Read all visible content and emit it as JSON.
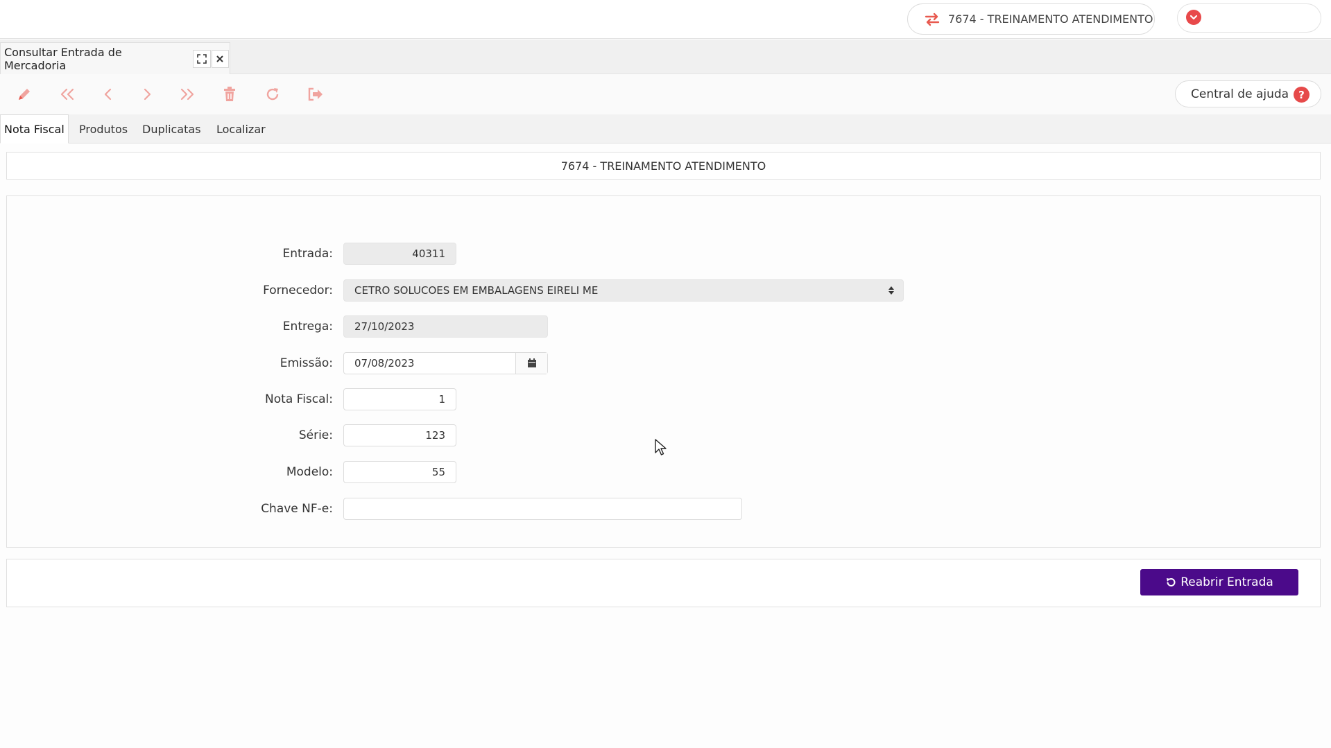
{
  "topbar": {
    "company_label": "7674 - TREINAMENTO ATENDIMENTO",
    "switch_icon": "switch-arrows-icon",
    "user_icon": "chevron-down-icon"
  },
  "window_tab": {
    "title": "Consultar Entrada de Mercadoria",
    "maximize_icon": "maximize-icon",
    "close_icon": "close-icon"
  },
  "toolbar": {
    "icons": [
      "pencil-icon",
      "first-icon",
      "previous-icon",
      "next-icon",
      "last-icon",
      "trash-icon",
      "refresh-icon",
      "exit-icon"
    ],
    "help_label": "Central de ajuda",
    "help_glyph": "?"
  },
  "tabs": [
    {
      "label": "Nota Fiscal",
      "active": true
    },
    {
      "label": "Produtos",
      "active": false
    },
    {
      "label": "Duplicatas",
      "active": false
    },
    {
      "label": "Localizar",
      "active": false
    }
  ],
  "company_header": "7674 - TREINAMENTO ATENDIMENTO",
  "form": {
    "entrada": {
      "label": "Entrada:",
      "value": "40311"
    },
    "fornecedor": {
      "label": "Fornecedor:",
      "value": "CETRO SOLUCOES EM EMBALAGENS EIRELI ME"
    },
    "entrega": {
      "label": "Entrega:",
      "value": "27/10/2023"
    },
    "emissao": {
      "label": "Emissão:",
      "value": "07/08/2023"
    },
    "nota_fiscal": {
      "label": "Nota Fiscal:",
      "value": "1"
    },
    "serie": {
      "label": "Série:",
      "value": "123"
    },
    "modelo": {
      "label": "Modelo:",
      "value": "55"
    },
    "chave": {
      "label": "Chave NF-e:",
      "value": ""
    }
  },
  "actions": {
    "reopen_label": "Reabrir Entrada"
  },
  "colors": {
    "accent": "#e8594f",
    "primary_button": "#4b0a8a"
  }
}
